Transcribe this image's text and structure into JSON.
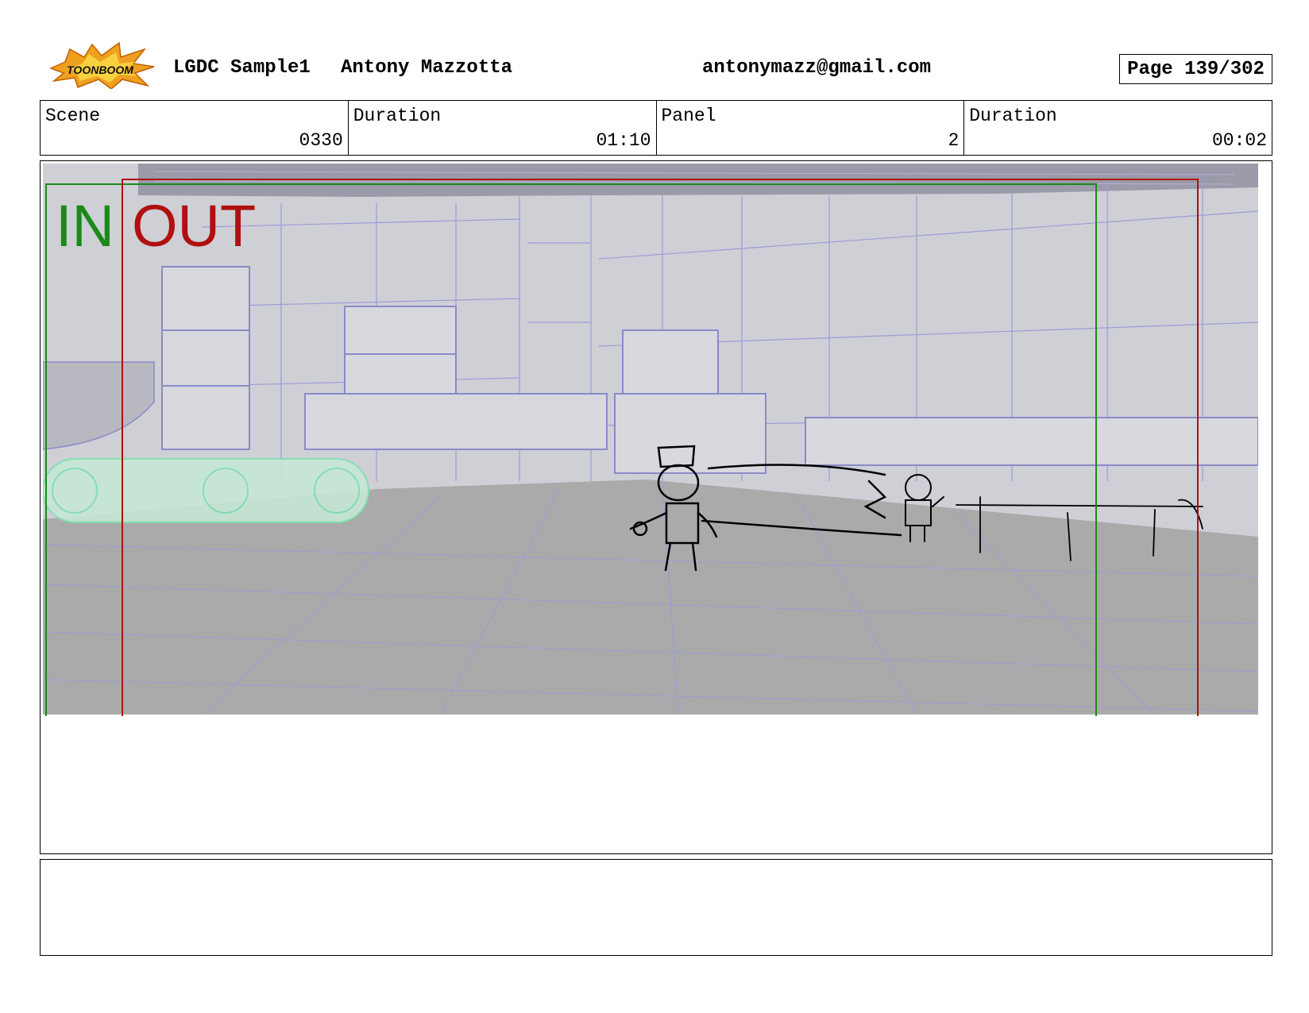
{
  "header": {
    "logo_text": "TOONBOOM",
    "project": "LGDC Sample1",
    "author": "Antony Mazzotta",
    "email": "antonymazz@gmail.com",
    "page": "Page 139/302"
  },
  "info": {
    "scene_label": "Scene",
    "scene_value": "0330",
    "scene_duration_label": "Duration",
    "scene_duration_value": "01:10",
    "panel_label": "Panel",
    "panel_value": "2",
    "panel_duration_label": "Duration",
    "panel_duration_value": "00:02"
  },
  "panel": {
    "in_label": "IN",
    "out_label": "OUT",
    "in_color": "#1a8a1a",
    "out_color": "#b01010"
  },
  "notes": {
    "text": ""
  }
}
